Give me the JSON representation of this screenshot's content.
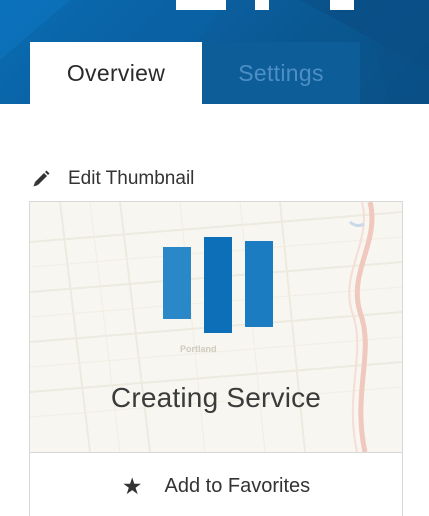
{
  "tabs": {
    "overview_label": "Overview",
    "settings_label": "Settings"
  },
  "thumbnail": {
    "edit_label": "Edit Thumbnail",
    "map_place_label": "Portland",
    "status_text": "Creating Service"
  },
  "favorites": {
    "label": "Add to Favorites"
  },
  "icons": {
    "edit": "pencil-icon",
    "loading": "loading-bars-icon",
    "favorite": "star-icon"
  },
  "colors": {
    "header_blue": "#0b5f9f",
    "loader_blue": "#1a80c6",
    "text": "#333333"
  }
}
